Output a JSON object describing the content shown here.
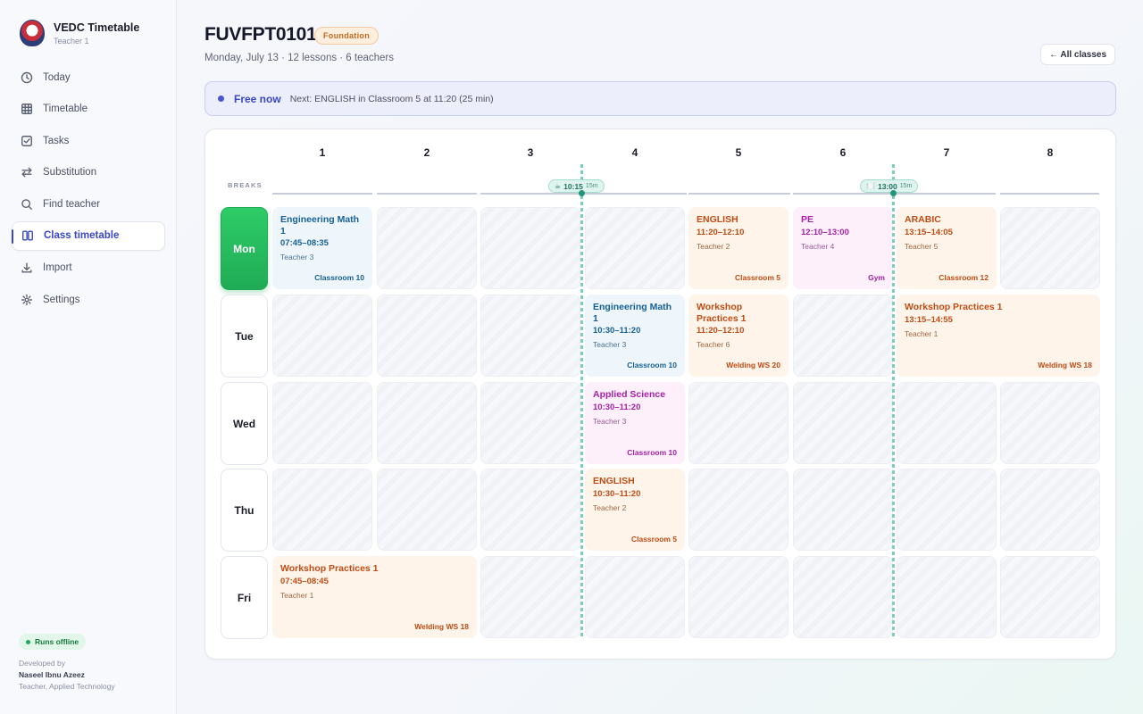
{
  "sidebar": {
    "brand_title": "VEDC Timetable",
    "brand_sub": "Teacher 1",
    "nav": [
      {
        "label": "Today",
        "icon": "clock-icon"
      },
      {
        "label": "Timetable",
        "icon": "grid-icon"
      },
      {
        "label": "Tasks",
        "icon": "checkbox-icon"
      },
      {
        "label": "Substitution",
        "icon": "swap-icon"
      },
      {
        "label": "Find teacher",
        "icon": "search-icon"
      },
      {
        "label": "Class timetable",
        "icon": "columns-icon",
        "active": true
      },
      {
        "label": "Import",
        "icon": "download-icon"
      },
      {
        "label": "Settings",
        "icon": "gear-icon"
      }
    ],
    "offline_label": "Runs offline",
    "dev_by": "Developed by",
    "dev_name": "Naseel Ibnu Azeez",
    "dev_role": "Teacher, Applied Technology"
  },
  "header": {
    "class_code": "FUVFPT0101",
    "badge": "Foundation",
    "subtitle": "Monday, July 13 · 12 lessons · 6 teachers",
    "all_classes": "← All classes"
  },
  "status": {
    "free": "Free now",
    "next": "Next: ENGLISH in Classroom 5 at 11:20 (25 min)"
  },
  "grid": {
    "periods": [
      "1",
      "2",
      "3",
      "4",
      "5",
      "6",
      "7",
      "8"
    ],
    "breaks_label": "BREAKS",
    "breaks": [
      {
        "time": "10:15",
        "duration": "15m",
        "icon": "☕"
      },
      {
        "time": "13:00",
        "duration": "15m",
        "icon": "🍽️"
      }
    ],
    "days": [
      "Mon",
      "Tue",
      "Wed",
      "Thu",
      "Fri"
    ],
    "today": "Mon",
    "lessons": [
      {
        "day": "Mon",
        "subject": "Engineering Math 1",
        "time": "07:45–08:35",
        "teacher": "Teacher 3",
        "room": "Classroom 10"
      },
      {
        "day": "Mon",
        "subject": "ENGLISH",
        "time": "11:20–12:10",
        "teacher": "Teacher 2",
        "room": "Classroom 5"
      },
      {
        "day": "Mon",
        "subject": "PE",
        "time": "12:10–13:00",
        "teacher": "Teacher 4",
        "room": "Gym"
      },
      {
        "day": "Mon",
        "subject": "ARABIC",
        "time": "13:15–14:05",
        "teacher": "Teacher 5",
        "room": "Classroom 12"
      },
      {
        "day": "Tue",
        "subject": "Engineering Math 1",
        "time": "10:30–11:20",
        "teacher": "Teacher 3",
        "room": "Classroom 10"
      },
      {
        "day": "Tue",
        "subject": "Workshop Practices 1",
        "time": "11:20–12:10",
        "teacher": "Teacher 6",
        "room": "Welding WS 20"
      },
      {
        "day": "Tue",
        "subject": "Workshop Practices 1",
        "time": "13:15–14:55",
        "teacher": "Teacher 1",
        "room": "Welding WS 18"
      },
      {
        "day": "Wed",
        "subject": "Applied Science",
        "time": "10:30–11:20",
        "teacher": "Teacher 3",
        "room": "Classroom 10"
      },
      {
        "day": "Thu",
        "subject": "ENGLISH",
        "time": "10:30–11:20",
        "teacher": "Teacher 2",
        "room": "Classroom 5"
      },
      {
        "day": "Fri",
        "subject": "Workshop Practices 1",
        "time": "07:45–08:45",
        "teacher": "Teacher 1",
        "room": "Welding WS 18"
      }
    ]
  },
  "colors": {
    "accent": "#3847c9",
    "today": "#1fab55",
    "break": "#7dcfbb",
    "lesson_blue": "#176096",
    "lesson_orange": "#c04c14",
    "lesson_pink": "#a521a5"
  }
}
